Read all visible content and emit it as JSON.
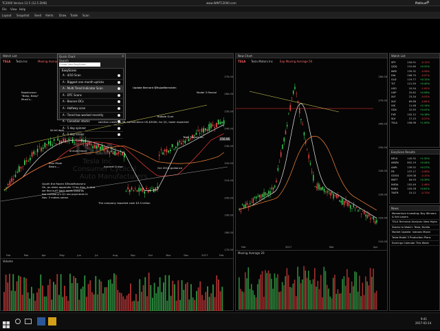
{
  "window": {
    "title": "TC2000 Version 12.5 (12.5 ZIAB)",
    "url": "www.WWTC2000.com",
    "brand": "Platinum"
  },
  "menu": [
    "File",
    "View",
    "Help"
  ],
  "toolbar": [
    "Layout",
    "Snapshot",
    "Send",
    "Alerts",
    "Draw",
    "Trade",
    "Scan"
  ],
  "left_chart": {
    "header": "Watch List",
    "symbol": "TSLA",
    "name": "Tesla Inc",
    "indicator": "Moving Average 50",
    "watermark_symbol": "TSLA",
    "watermark_line1": "Tesla Inc",
    "watermark_line2": "Consumer Cyclical",
    "watermark_line3": "Auto Manufacturers",
    "volume_label": "Volume",
    "x_labels": [
      "Feb",
      "Mar",
      "Apr",
      "May",
      "Jun",
      "Jul",
      "Aug",
      "Sep",
      "Oct",
      "Nov",
      "Dec",
      "2017",
      "Feb"
    ],
    "y_labels": [
      "270.00",
      "260.00",
      "250.00",
      "240.00",
      "230.00",
      "220.00",
      "210.00",
      "200.00",
      "190.00",
      "180.00",
      "170.00"
    ],
    "price_tag": "256.96",
    "notes": [
      "Roadrunner",
      "\"Beep, Beep\"",
      "Musk's...",
      "$4 bil deal",
      "Elon Musk",
      "Bears ...",
      "Quoth the Raven $TeslaMotorsInc",
      "Oh, an elder appendix I'll be Alas, & that",
      "we find out? back loads towards",
      "the company's Q1 tax payments hi",
      "Nov. 3 makes sense."
    ],
    "callout_top": "Update Bernard @ItsJoeBernstein",
    "callout_mid": "sale/tax credit $1.3B, convenience US-$300K, for Q1, lower expected",
    "callout_bottom": "The company reported cash $3.5 billion",
    "ann_right_1": "Bubble Gum",
    "ann_right_2": "Ancient Cruise",
    "ann_right_3": "Model 3 Reveal",
    "ann_right_4": "Tesla Motors Inc",
    "ann_mid_1": "annual report",
    "ann_mid_2": "Oct 2016 guidance"
  },
  "dropdown": {
    "title": "Quick Chart",
    "search_label": "Search",
    "search_placeholder": "Create View EasyScans",
    "section": "EasyScans",
    "items": [
      "A - 4/10 Scan",
      "A - Biggest one month upticks",
      "A - Multi Trend Indicator Scan",
      "A - DTC Scans",
      "A - Bounce DCs",
      "A - Halfway scan",
      "A - Trend has worked recently",
      "A - Canadian stocks",
      "A - 5 day spinner",
      "A - 5 day losses"
    ]
  },
  "right_chart": {
    "header": "New Chart",
    "symbol": "TSLA",
    "name": "Tesla Motors Inc",
    "indicator": "Exp Moving Average 50",
    "x_labels": [
      "Feb",
      "2017",
      "Mar",
      "Apr"
    ],
    "y_labels": [
      "280.00",
      "270.00",
      "260.00",
      "250.00",
      "240.00",
      "230.00",
      "220.00",
      "210.00"
    ],
    "volume_label": "Moving Average 20"
  },
  "watchlist": {
    "header": "Watch List",
    "title": "Notes",
    "rows": [
      {
        "sym": "SPY",
        "price": "234.91",
        "chg": "-0.12%"
      },
      {
        "sym": "QQQ",
        "price": "131.60",
        "chg": "+0.31%"
      },
      {
        "sym": "IWM",
        "price": "135.32",
        "chg": "-0.56%"
      },
      {
        "sym": "DIA",
        "price": "206.70",
        "chg": "-0.07%"
      },
      {
        "sym": "GLD",
        "price": "119.77",
        "chg": "+0.12%"
      },
      {
        "sym": "TLT",
        "price": "121.50",
        "chg": "+0.40%"
      },
      {
        "sym": "USO",
        "price": "10.54",
        "chg": "-1.02%"
      },
      {
        "sym": "UUP",
        "price": "25.62",
        "chg": "+0.08%"
      },
      {
        "sym": "XLF",
        "price": "23.34",
        "chg": "-0.52%"
      },
      {
        "sym": "XLE",
        "price": "69.88",
        "chg": "-0.84%"
      },
      {
        "sym": "VIX",
        "price": "11.48",
        "chg": "+2.14%"
      },
      {
        "sym": "GDX",
        "price": "22.63",
        "chg": "+0.41%"
      },
      {
        "sym": "FXE",
        "price": "102.12",
        "chg": "+0.18%"
      },
      {
        "sym": "SLV",
        "price": "17.15",
        "chg": "-0.27%"
      },
      {
        "sym": "TSLA",
        "price": "256.96",
        "chg": "+1.09%"
      }
    ]
  },
  "sector_list": {
    "header": "EasyScan Results",
    "rows": [
      {
        "sym": "NFLX",
        "price": "142.92",
        "chg": "+1.32%"
      },
      {
        "sym": "AMZN",
        "price": "852.19",
        "chg": "+0.44%"
      },
      {
        "sym": "AAPL",
        "price": "139.52",
        "chg": "+0.27%"
      },
      {
        "sym": "FB",
        "price": "137.17",
        "chg": "-0.08%"
      },
      {
        "sym": "GOOG",
        "price": "829.08",
        "chg": "-0.15%"
      },
      {
        "sym": "MSFT",
        "price": "64.93",
        "chg": "+0.39%"
      },
      {
        "sym": "NVDA",
        "price": "102.49",
        "chg": "-1.46%"
      },
      {
        "sym": "BABA",
        "price": "103.28",
        "chg": "+0.61%"
      },
      {
        "sym": "TWTR",
        "price": "15.12",
        "chg": "-0.73%"
      }
    ]
  },
  "news": {
    "header": "News",
    "items": [
      "Momentum Investing: Buy Winners & Sell Losers",
      "TSLA Technical Analysis: New Highs",
      "Stocks to Watch: Tesla, Nvidia",
      "Market Update: Indexes Mixed",
      "Tesla Model 3 Production Plans",
      "Earnings Calendar This Week"
    ]
  },
  "taskbar": {
    "time": "9:41",
    "date": "2017-03-14"
  },
  "colors": {
    "up": "#3ee05a",
    "down": "#ff4b4b",
    "ma_red": "#ff3b3b",
    "ma_white": "#f0f0f0",
    "ann_yellow": "#e8e060"
  }
}
